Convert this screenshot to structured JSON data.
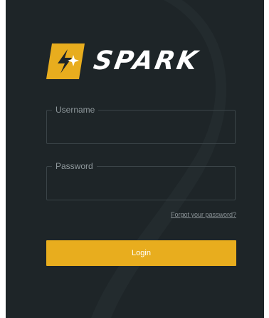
{
  "brand": {
    "name": "SPARK",
    "logo_icon": "spark-logo-icon",
    "accent_color": "#e8ad1e",
    "background_color": "#1e2528"
  },
  "form": {
    "username": {
      "label": "Username",
      "value": "",
      "placeholder": ""
    },
    "password": {
      "label": "Password",
      "value": "",
      "placeholder": ""
    },
    "forgot_link": "Forgot your password?",
    "login_label": "Login"
  }
}
